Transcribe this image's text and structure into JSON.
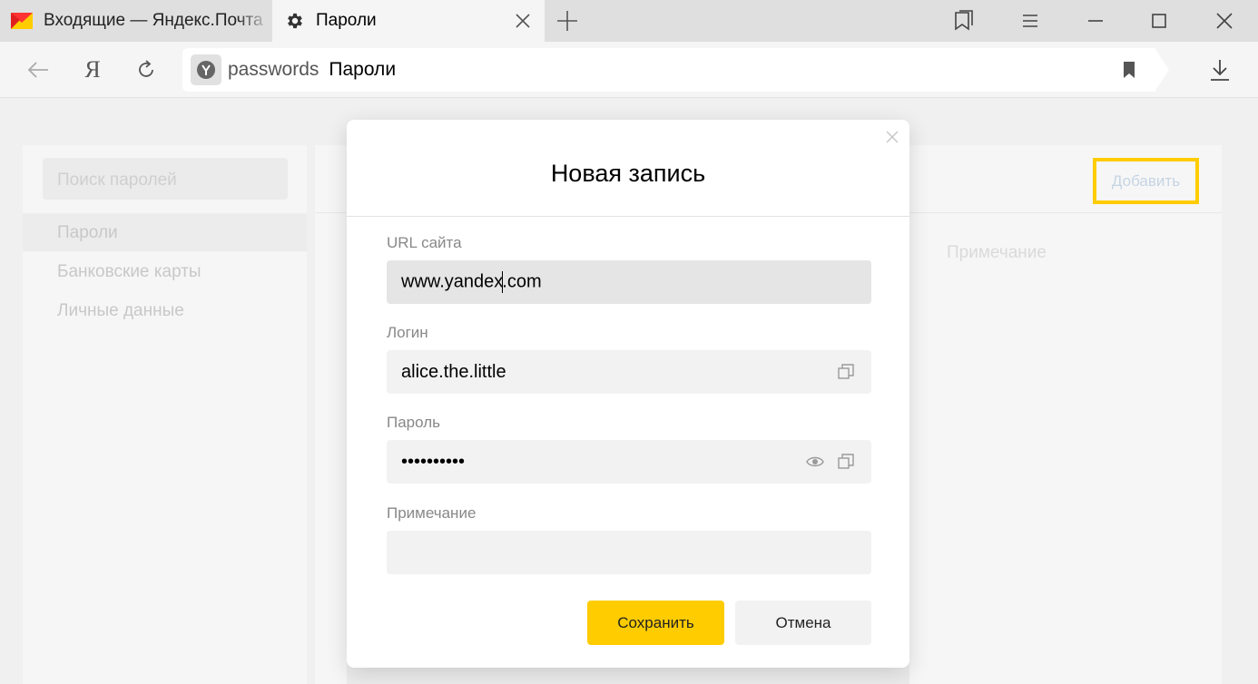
{
  "tabs": [
    {
      "title": "Входящие — Яндекс.Почта",
      "icon": "yandex-mail-icon",
      "active": false
    },
    {
      "title": "Пароли",
      "icon": "gear-icon",
      "active": true
    }
  ],
  "toolbar": {
    "ya_label": "Я",
    "url_host": "passwords",
    "url_title": "Пароли"
  },
  "sidebar": {
    "search_placeholder": "Поиск паролей",
    "items": [
      {
        "label": "Пароли",
        "active": true
      },
      {
        "label": "Банковские карты",
        "active": false
      },
      {
        "label": "Личные данные",
        "active": false
      }
    ]
  },
  "content": {
    "add_label": "Добавить",
    "column_note": "Примечание"
  },
  "modal": {
    "title": "Новая запись",
    "fields": {
      "url": {
        "label": "URL сайта",
        "value_before_caret": "www.yandex",
        "value_after_caret": ".com"
      },
      "login": {
        "label": "Логин",
        "value": "alice.the.little"
      },
      "password": {
        "label": "Пароль",
        "value": "••••••••••"
      },
      "note": {
        "label": "Примечание",
        "value": ""
      }
    },
    "save_label": "Сохранить",
    "cancel_label": "Отмена"
  },
  "colors": {
    "accent": "#ffcc00",
    "mail_logo_red": "#ff3333",
    "mail_logo_yellow": "#ffcc00"
  }
}
